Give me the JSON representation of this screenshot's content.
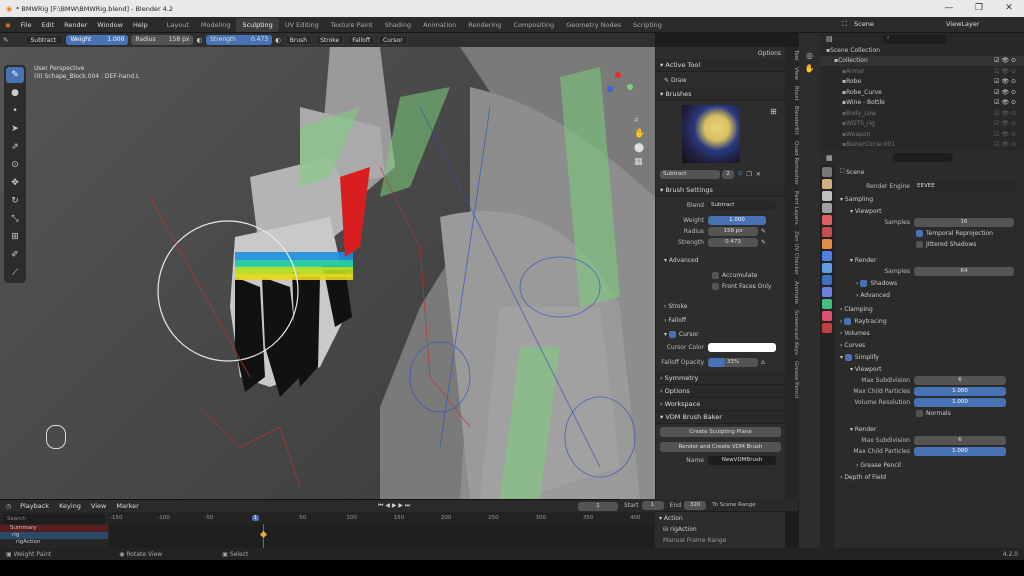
{
  "window": {
    "title": "* BMWRig [F:\\BMW\\BMWRig.blend] - Blender 4.2",
    "controls": [
      "—",
      "❐",
      "✕"
    ]
  },
  "menu": [
    "File",
    "Edit",
    "Render",
    "Window",
    "Help"
  ],
  "workspaces": [
    "Layout",
    "Modeling",
    "Sculpting",
    "UV Editing",
    "Texture Paint",
    "Shading",
    "Animation",
    "Rendering",
    "Compositing",
    "Geometry Nodes",
    "Scripting"
  ],
  "active_workspace": "Sculpting",
  "scene": {
    "name": "Scene",
    "view_layer": "ViewLayer"
  },
  "header": {
    "mode": "Weight Paint",
    "view": "View",
    "weights": "Weights",
    "vertex_group": "DEF-hand.L",
    "blend": "Subtract",
    "weight_label": "Weight",
    "weight_value": "1.000",
    "radius_label": "Radius",
    "radius_value": "158 px",
    "strength_label": "Strength",
    "strength_value": "0.473",
    "brush": "Brush",
    "stroke": "Stroke",
    "falloff": "Falloff",
    "cursor": "Cursor",
    "options": "Options"
  },
  "viewport": {
    "title": "User Perspective",
    "subtitle": "(0) Schape_Block.004 : DEF-hand.L"
  },
  "npanel": {
    "active_tool": "Active Tool",
    "tool_name": "Draw",
    "brushes": "Brushes",
    "brush_name": "Subtract",
    "brush_users": "2",
    "brush_settings": "Brush Settings",
    "blend_label": "Blend",
    "blend_value": "Subtract",
    "weight_label": "Weight",
    "weight_value": "1.000",
    "radius_label": "Radius",
    "radius_value": "158 px",
    "strength_label": "Strength",
    "strength_value": "0.473",
    "advanced": "Advanced",
    "accumulate": "Accumulate",
    "front_faces": "Front Faces Only",
    "stroke": "Stroke",
    "falloff": "Falloff",
    "cursor": "Cursor",
    "cursor_color": "Cursor Color",
    "falloff_opacity": "Falloff Opacity",
    "falloff_opacity_value": "33%",
    "symmetry": "Symmetry",
    "options": "Options",
    "workspace": "Workspace",
    "vdm": "VDM Brush Baker",
    "create_plane": "Create Sculpting Plane",
    "render_vdm": "Render and Create VDM Brush",
    "name_label": "Name",
    "name_value": "NewVDMBrush"
  },
  "side_tabs": [
    "Tool",
    "View",
    "Rtext",
    "BlenderKit",
    "Quad Remesher",
    "Paint Layers",
    "Zen UV Checker",
    "Animate",
    "Screencast Keys",
    "Grease Pencil"
  ],
  "outliner": {
    "search_placeholder": "",
    "rows": [
      {
        "name": "Scene Collection",
        "dim": false
      },
      {
        "name": "Collection",
        "dim": false
      },
      {
        "name": "Armar",
        "dim": true
      },
      {
        "name": "Robe",
        "dim": false
      },
      {
        "name": "Robe_Curve",
        "dim": false
      },
      {
        "name": "Wine - Bottle",
        "dim": false
      },
      {
        "name": "Body_Low",
        "dim": true
      },
      {
        "name": "WGTS_rig",
        "dim": true
      },
      {
        "name": "Weapon",
        "dim": true
      },
      {
        "name": "BezierCircle.001",
        "dim": true
      }
    ]
  },
  "props": {
    "scene": "Scene",
    "render_engine_label": "Render Engine",
    "render_engine": "EEVEE",
    "sampling": "Sampling",
    "viewport": "Viewport",
    "samples_label": "Samples",
    "samples_vp": "16",
    "temporal": "Temporal Reprojection",
    "jittered": "Jittered Shadows",
    "render": "Render",
    "samples_r": "64",
    "shadows": "Shadows",
    "advanced": "Advanced",
    "clamping": "Clamping",
    "raytracing": "Raytracing",
    "volumes": "Volumes",
    "curves": "Curves",
    "simplify": "Simplify",
    "viewport2": "Viewport",
    "max_subdiv_label": "Max Subdivision",
    "max_subdiv": "6",
    "max_child_label": "Max Child Particles",
    "max_child": "1.000",
    "vol_res_label": "Volume Resolution",
    "vol_res": "1.000",
    "normals": "Normals",
    "render2": "Render",
    "max_subdiv_r": "6",
    "max_child_r": "1.000",
    "grease": "Grease Pencil",
    "dof": "Depth of Field"
  },
  "timeline": {
    "playback": "Playback",
    "keying": "Keying",
    "view": "View",
    "marker": "Marker",
    "current": "1",
    "start_label": "Start",
    "start": "1",
    "end_label": "End",
    "end": "320",
    "to_scene": "To Scene Range",
    "ticks": [
      "-150",
      "-100",
      "-50",
      "1",
      "50",
      "100",
      "150",
      "200",
      "250",
      "300",
      "350",
      "400"
    ],
    "frame_marker": "1",
    "search_placeholder": "Search",
    "tracks": [
      "Summary",
      "rig",
      "rigAction"
    ]
  },
  "action": {
    "title": "Action",
    "item": "rigAction",
    "item2": "Manual Frame Range"
  },
  "status": {
    "left": "Weight Paint",
    "mid": "Rotate View",
    "sel": "Select",
    "version": "4.2.0"
  },
  "colors": {
    "accent": "#4772b3",
    "header_bg": "#2b2b2b"
  }
}
